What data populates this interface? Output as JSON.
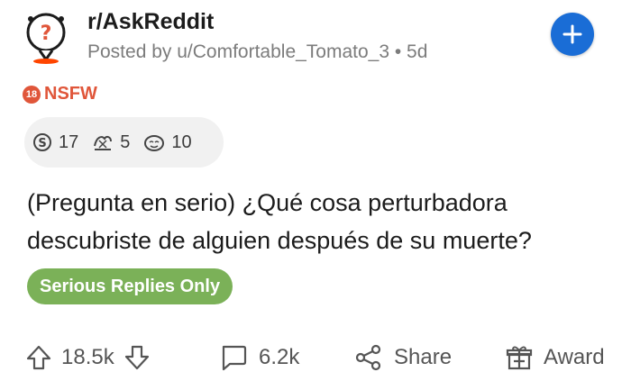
{
  "header": {
    "subreddit": "r/AskReddit",
    "posted_by": "Posted by u/Comfortable_Tomato_3 • 5d"
  },
  "tag": {
    "badge": "18",
    "label": "NSFW",
    "color": "#e0563a"
  },
  "awards": [
    {
      "icon": "silver-award-icon",
      "count": "17"
    },
    {
      "icon": "helpful-award-icon",
      "count": "5"
    },
    {
      "icon": "wholesome-award-icon",
      "count": "10"
    }
  ],
  "post": {
    "title_line1": "(Pregunta en serio) ¿Qué cosa perturbadora",
    "title_line2": "descubriste de alguien después de su muerte?"
  },
  "flair": {
    "label": "Serious Replies Only",
    "color": "#7bb158"
  },
  "actions": {
    "votes": "18.5k",
    "comments": "6.2k",
    "share": "Share",
    "award": "Award"
  },
  "colors": {
    "accent": "#1a6dd6"
  }
}
